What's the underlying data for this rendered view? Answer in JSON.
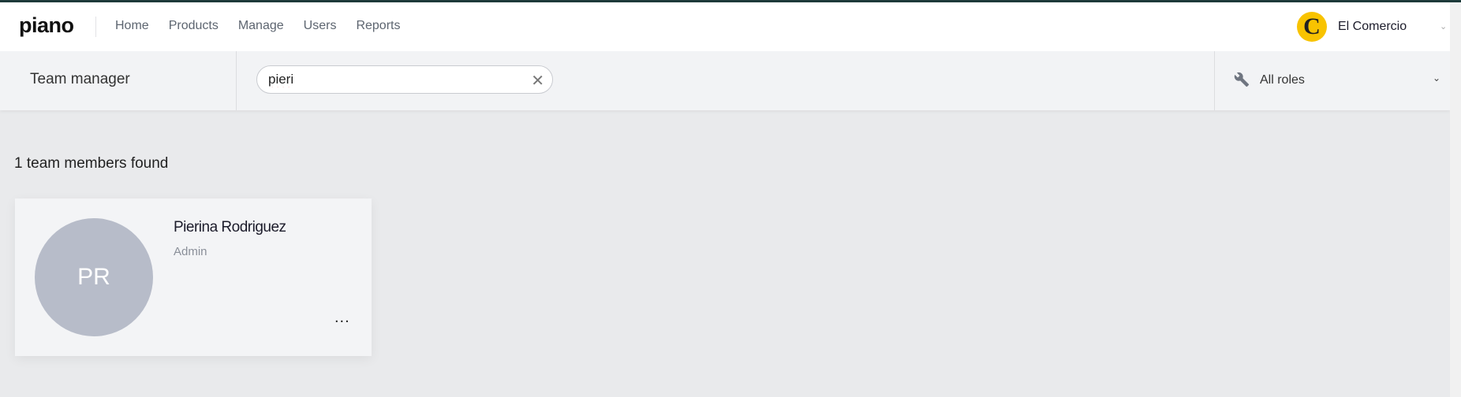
{
  "header": {
    "logo": "piano",
    "nav": [
      "Home",
      "Products",
      "Manage",
      "Users",
      "Reports"
    ],
    "publisher": {
      "logo_letter": "C",
      "name": "El Comercio",
      "logo_color": "#f8c300"
    }
  },
  "subheader": {
    "title": "Team manager",
    "search": {
      "value": "pieri",
      "placeholder": ""
    },
    "roles_filter": {
      "selected": "All roles",
      "icon": "wrench-icon"
    }
  },
  "results": {
    "count_label": "1 team members found",
    "members": [
      {
        "initials": "PR",
        "name": "Pierina Rodriguez",
        "role": "Admin",
        "menu": "..."
      }
    ]
  }
}
